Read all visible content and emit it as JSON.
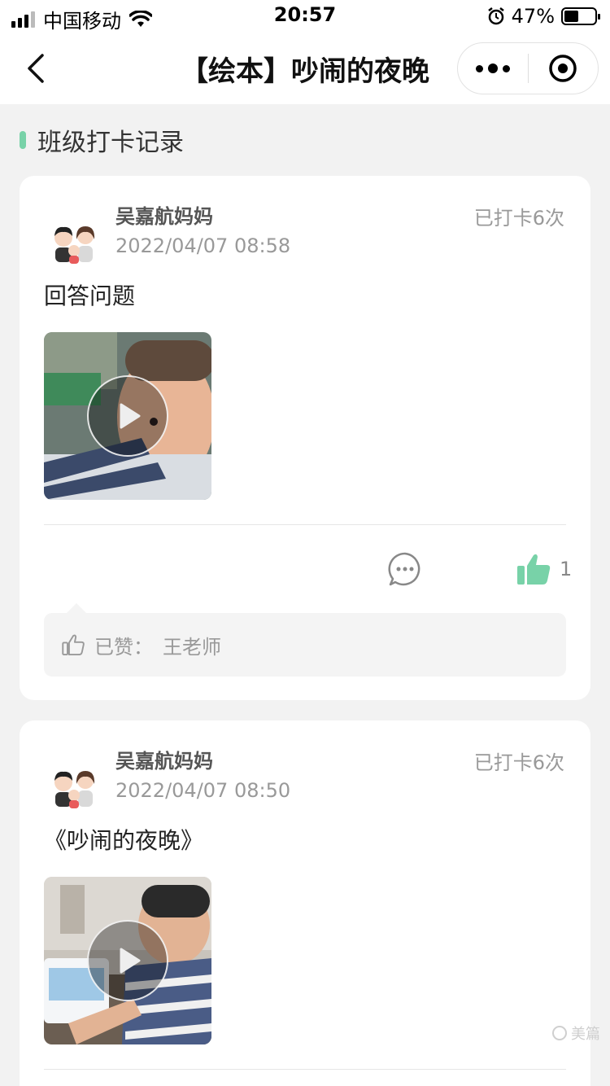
{
  "status_bar": {
    "carrier": "中国移动",
    "time": "20:57",
    "battery_percent": "47%",
    "battery_level": 0.47
  },
  "nav": {
    "title": "【绘本】吵闹的夜晚",
    "back_icon": "chevron-left-icon",
    "more_icon": "more-dots-icon",
    "close_icon": "target-close-icon"
  },
  "section": {
    "title": "班级打卡记录",
    "accent_color": "#78d2a8"
  },
  "posts": [
    {
      "author": "吴嘉航妈妈",
      "datetime": "2022/04/07 08:58",
      "checkin_count": "已打卡6次",
      "text": "回答问题",
      "like_count": "1",
      "liked": true,
      "likes_label": "已赞：",
      "likes_names": "王老师"
    },
    {
      "author": "吴嘉航妈妈",
      "datetime": "2022/04/07 08:50",
      "checkin_count": "已打卡6次",
      "text": "《吵闹的夜晚》"
    }
  ],
  "watermark": "美篇",
  "colors": {
    "accent": "#78d2a8",
    "like_active": "#78d2a8"
  }
}
